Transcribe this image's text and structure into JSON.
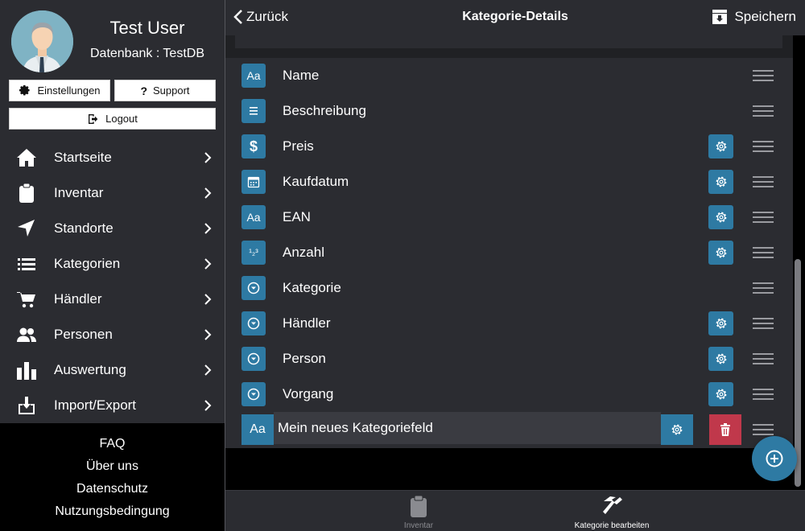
{
  "sidebar": {
    "user_name": "Test User",
    "database_label": "Datenbank : TestDB",
    "settings_label": "Einstellungen",
    "support_label": "Support",
    "logout_label": "Logout",
    "nav_items": [
      {
        "label": "Startseite",
        "icon": "home-icon"
      },
      {
        "label": "Inventar",
        "icon": "clipboard-icon"
      },
      {
        "label": "Standorte",
        "icon": "location-arrow-icon"
      },
      {
        "label": "Kategorien",
        "icon": "list-icon"
      },
      {
        "label": "Händler",
        "icon": "cart-icon"
      },
      {
        "label": "Personen",
        "icon": "people-icon"
      },
      {
        "label": "Auswertung",
        "icon": "bar-chart-icon"
      },
      {
        "label": "Import/Export",
        "icon": "download-icon"
      }
    ],
    "footer_links": [
      "FAQ",
      "Über uns",
      "Datenschutz",
      "Nutzungsbedingung"
    ]
  },
  "header": {
    "back_label": "Zurück",
    "title": "Kategorie-Details",
    "save_label": "Speichern"
  },
  "fields": [
    {
      "name": "Name",
      "type_icon": "text-type-icon",
      "has_settings": false
    },
    {
      "name": "Beschreibung",
      "type_icon": "paragraph-type-icon",
      "has_settings": false
    },
    {
      "name": "Preis",
      "type_icon": "dollar-type-icon",
      "has_settings": true
    },
    {
      "name": "Kaufdatum",
      "type_icon": "calendar-type-icon",
      "has_settings": true
    },
    {
      "name": "EAN",
      "type_icon": "text-type-icon",
      "has_settings": true
    },
    {
      "name": "Anzahl",
      "type_icon": "number-type-icon",
      "has_settings": true
    },
    {
      "name": "Kategorie",
      "type_icon": "dropdown-type-icon",
      "has_settings": false
    },
    {
      "name": "Händler",
      "type_icon": "dropdown-type-icon",
      "has_settings": true
    },
    {
      "name": "Person",
      "type_icon": "dropdown-type-icon",
      "has_settings": true
    },
    {
      "name": "Vorgang",
      "type_icon": "dropdown-type-icon",
      "has_settings": true
    }
  ],
  "new_field": {
    "value": "Mein neues Kategoriefeld",
    "type_icon": "text-type-icon"
  },
  "type_text_glyph": "Aa",
  "type_number_glyph": "¹₂³",
  "tabs": [
    {
      "label": "Inventar",
      "active": false
    },
    {
      "label": "Kategorie bearbeiten",
      "active": true
    }
  ],
  "colors": {
    "accent": "#2e7aa3",
    "danger": "#c0384b",
    "panel": "#2b2c31"
  }
}
